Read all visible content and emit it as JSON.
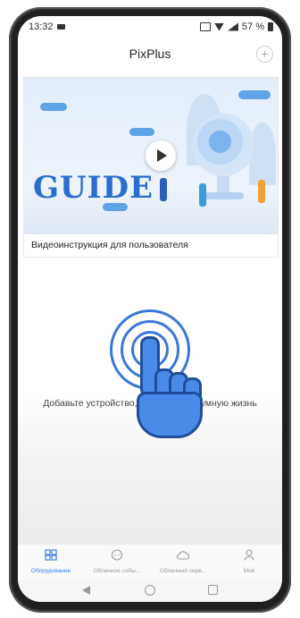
{
  "status_bar": {
    "time": "13:32",
    "battery": "57 %"
  },
  "header": {
    "title": "PixPlus",
    "add_label": "+"
  },
  "guide_card": {
    "banner_text": "GUIDE",
    "caption": "Видеоинструкция для пользователя"
  },
  "empty_state": {
    "message": "Добавьте устройство, чтобы начать умную жизнь"
  },
  "tabs": [
    {
      "label": "Оборудование",
      "icon": "devices-icon",
      "active": true
    },
    {
      "label": "Облачное собы...",
      "icon": "cloud-events-icon",
      "active": false
    },
    {
      "label": "Облачный серв...",
      "icon": "cloud-service-icon",
      "active": false
    },
    {
      "label": "Моё",
      "icon": "profile-icon",
      "active": false
    }
  ],
  "colors": {
    "accent": "#3b7ee6",
    "guide_blue": "#2a6fcf"
  }
}
